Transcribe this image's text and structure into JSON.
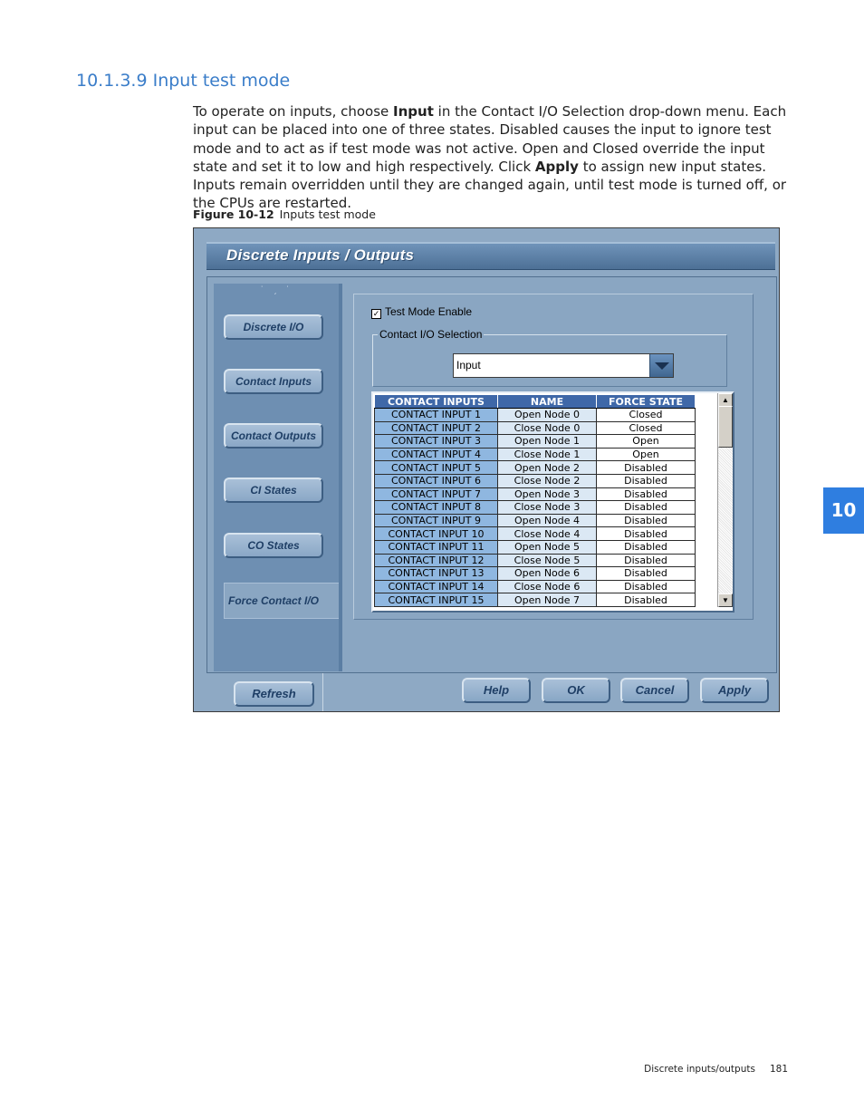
{
  "heading": "10.1.3.9 Input test mode",
  "paragraph": {
    "p1": "To operate on inputs, choose ",
    "b1": "Input",
    "p2": " in the Contact I/O Selection drop-down menu. Each input can be placed into one of three states. Disabled causes the input to ignore test mode and to act as if test mode was not active. Open and Closed override the input state and set it to low and high respectively. Click ",
    "b2": "Apply",
    "p3": " to assign new input states. Inputs remain overridden until they are changed again, until test mode is turned off, or the CPUs are restarted."
  },
  "figure": {
    "number": "Figure 10-12",
    "caption": "Inputs test mode"
  },
  "window": {
    "title": "Discrete Inputs / Outputs",
    "nav": [
      {
        "label": "Discrete I/O"
      },
      {
        "label": "Contact Inputs"
      },
      {
        "label": "Contact Outputs"
      },
      {
        "label": "CI States"
      },
      {
        "label": "CO States"
      },
      {
        "label": "Force Contact I/O"
      }
    ],
    "test_mode_label": "Test Mode Enable",
    "test_mode_checked": "✓",
    "group_label": "Contact I/O Selection",
    "selection_value": "Input",
    "grid": {
      "headers": [
        "CONTACT INPUTS",
        "NAME",
        "FORCE STATE"
      ],
      "rows": [
        [
          "CONTACT INPUT 1",
          "Open Node 0",
          "Closed"
        ],
        [
          "CONTACT INPUT 2",
          "Close Node 0",
          "Closed"
        ],
        [
          "CONTACT INPUT 3",
          "Open Node 1",
          "Open"
        ],
        [
          "CONTACT INPUT 4",
          "Close Node 1",
          "Open"
        ],
        [
          "CONTACT INPUT 5",
          "Open Node 2",
          "Disabled"
        ],
        [
          "CONTACT INPUT 6",
          "Close Node 2",
          "Disabled"
        ],
        [
          "CONTACT INPUT 7",
          "Open Node 3",
          "Disabled"
        ],
        [
          "CONTACT INPUT 8",
          "Close Node 3",
          "Disabled"
        ],
        [
          "CONTACT INPUT 9",
          "Open Node 4",
          "Disabled"
        ],
        [
          "CONTACT INPUT 10",
          "Close Node 4",
          "Disabled"
        ],
        [
          "CONTACT INPUT 11",
          "Open Node 5",
          "Disabled"
        ],
        [
          "CONTACT INPUT 12",
          "Close Node 5",
          "Disabled"
        ],
        [
          "CONTACT INPUT 13",
          "Open Node 6",
          "Disabled"
        ],
        [
          "CONTACT INPUT 14",
          "Close Node 6",
          "Disabled"
        ],
        [
          "CONTACT INPUT 15",
          "Open Node 7",
          "Disabled"
        ]
      ]
    },
    "buttons": {
      "refresh": "Refresh",
      "help": "Help",
      "ok": "OK",
      "cancel": "Cancel",
      "apply": "Apply"
    }
  },
  "chapter_tab": "10",
  "footer": {
    "section": "Discrete inputs/outputs",
    "page": "181"
  }
}
